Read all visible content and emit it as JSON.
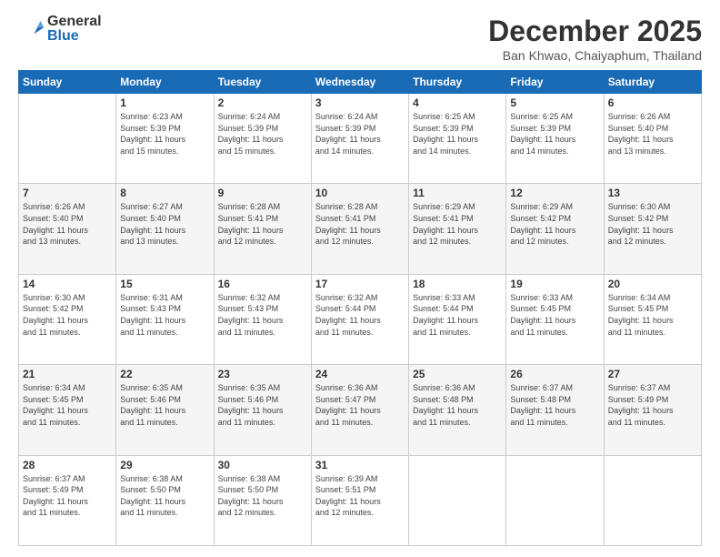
{
  "logo": {
    "general": "General",
    "blue": "Blue"
  },
  "header": {
    "month": "December 2025",
    "location": "Ban Khwao, Chaiyaphum, Thailand"
  },
  "weekdays": [
    "Sunday",
    "Monday",
    "Tuesday",
    "Wednesday",
    "Thursday",
    "Friday",
    "Saturday"
  ],
  "weeks": [
    [
      {
        "day": "",
        "info": ""
      },
      {
        "day": "1",
        "info": "Sunrise: 6:23 AM\nSunset: 5:39 PM\nDaylight: 11 hours\nand 15 minutes."
      },
      {
        "day": "2",
        "info": "Sunrise: 6:24 AM\nSunset: 5:39 PM\nDaylight: 11 hours\nand 15 minutes."
      },
      {
        "day": "3",
        "info": "Sunrise: 6:24 AM\nSunset: 5:39 PM\nDaylight: 11 hours\nand 14 minutes."
      },
      {
        "day": "4",
        "info": "Sunrise: 6:25 AM\nSunset: 5:39 PM\nDaylight: 11 hours\nand 14 minutes."
      },
      {
        "day": "5",
        "info": "Sunrise: 6:25 AM\nSunset: 5:39 PM\nDaylight: 11 hours\nand 14 minutes."
      },
      {
        "day": "6",
        "info": "Sunrise: 6:26 AM\nSunset: 5:40 PM\nDaylight: 11 hours\nand 13 minutes."
      }
    ],
    [
      {
        "day": "7",
        "info": "Sunrise: 6:26 AM\nSunset: 5:40 PM\nDaylight: 11 hours\nand 13 minutes."
      },
      {
        "day": "8",
        "info": "Sunrise: 6:27 AM\nSunset: 5:40 PM\nDaylight: 11 hours\nand 13 minutes."
      },
      {
        "day": "9",
        "info": "Sunrise: 6:28 AM\nSunset: 5:41 PM\nDaylight: 11 hours\nand 12 minutes."
      },
      {
        "day": "10",
        "info": "Sunrise: 6:28 AM\nSunset: 5:41 PM\nDaylight: 11 hours\nand 12 minutes."
      },
      {
        "day": "11",
        "info": "Sunrise: 6:29 AM\nSunset: 5:41 PM\nDaylight: 11 hours\nand 12 minutes."
      },
      {
        "day": "12",
        "info": "Sunrise: 6:29 AM\nSunset: 5:42 PM\nDaylight: 11 hours\nand 12 minutes."
      },
      {
        "day": "13",
        "info": "Sunrise: 6:30 AM\nSunset: 5:42 PM\nDaylight: 11 hours\nand 12 minutes."
      }
    ],
    [
      {
        "day": "14",
        "info": "Sunrise: 6:30 AM\nSunset: 5:42 PM\nDaylight: 11 hours\nand 11 minutes."
      },
      {
        "day": "15",
        "info": "Sunrise: 6:31 AM\nSunset: 5:43 PM\nDaylight: 11 hours\nand 11 minutes."
      },
      {
        "day": "16",
        "info": "Sunrise: 6:32 AM\nSunset: 5:43 PM\nDaylight: 11 hours\nand 11 minutes."
      },
      {
        "day": "17",
        "info": "Sunrise: 6:32 AM\nSunset: 5:44 PM\nDaylight: 11 hours\nand 11 minutes."
      },
      {
        "day": "18",
        "info": "Sunrise: 6:33 AM\nSunset: 5:44 PM\nDaylight: 11 hours\nand 11 minutes."
      },
      {
        "day": "19",
        "info": "Sunrise: 6:33 AM\nSunset: 5:45 PM\nDaylight: 11 hours\nand 11 minutes."
      },
      {
        "day": "20",
        "info": "Sunrise: 6:34 AM\nSunset: 5:45 PM\nDaylight: 11 hours\nand 11 minutes."
      }
    ],
    [
      {
        "day": "21",
        "info": "Sunrise: 6:34 AM\nSunset: 5:45 PM\nDaylight: 11 hours\nand 11 minutes."
      },
      {
        "day": "22",
        "info": "Sunrise: 6:35 AM\nSunset: 5:46 PM\nDaylight: 11 hours\nand 11 minutes."
      },
      {
        "day": "23",
        "info": "Sunrise: 6:35 AM\nSunset: 5:46 PM\nDaylight: 11 hours\nand 11 minutes."
      },
      {
        "day": "24",
        "info": "Sunrise: 6:36 AM\nSunset: 5:47 PM\nDaylight: 11 hours\nand 11 minutes."
      },
      {
        "day": "25",
        "info": "Sunrise: 6:36 AM\nSunset: 5:48 PM\nDaylight: 11 hours\nand 11 minutes."
      },
      {
        "day": "26",
        "info": "Sunrise: 6:37 AM\nSunset: 5:48 PM\nDaylight: 11 hours\nand 11 minutes."
      },
      {
        "day": "27",
        "info": "Sunrise: 6:37 AM\nSunset: 5:49 PM\nDaylight: 11 hours\nand 11 minutes."
      }
    ],
    [
      {
        "day": "28",
        "info": "Sunrise: 6:37 AM\nSunset: 5:49 PM\nDaylight: 11 hours\nand 11 minutes."
      },
      {
        "day": "29",
        "info": "Sunrise: 6:38 AM\nSunset: 5:50 PM\nDaylight: 11 hours\nand 11 minutes."
      },
      {
        "day": "30",
        "info": "Sunrise: 6:38 AM\nSunset: 5:50 PM\nDaylight: 11 hours\nand 12 minutes."
      },
      {
        "day": "31",
        "info": "Sunrise: 6:39 AM\nSunset: 5:51 PM\nDaylight: 11 hours\nand 12 minutes."
      },
      {
        "day": "",
        "info": ""
      },
      {
        "day": "",
        "info": ""
      },
      {
        "day": "",
        "info": ""
      }
    ]
  ]
}
